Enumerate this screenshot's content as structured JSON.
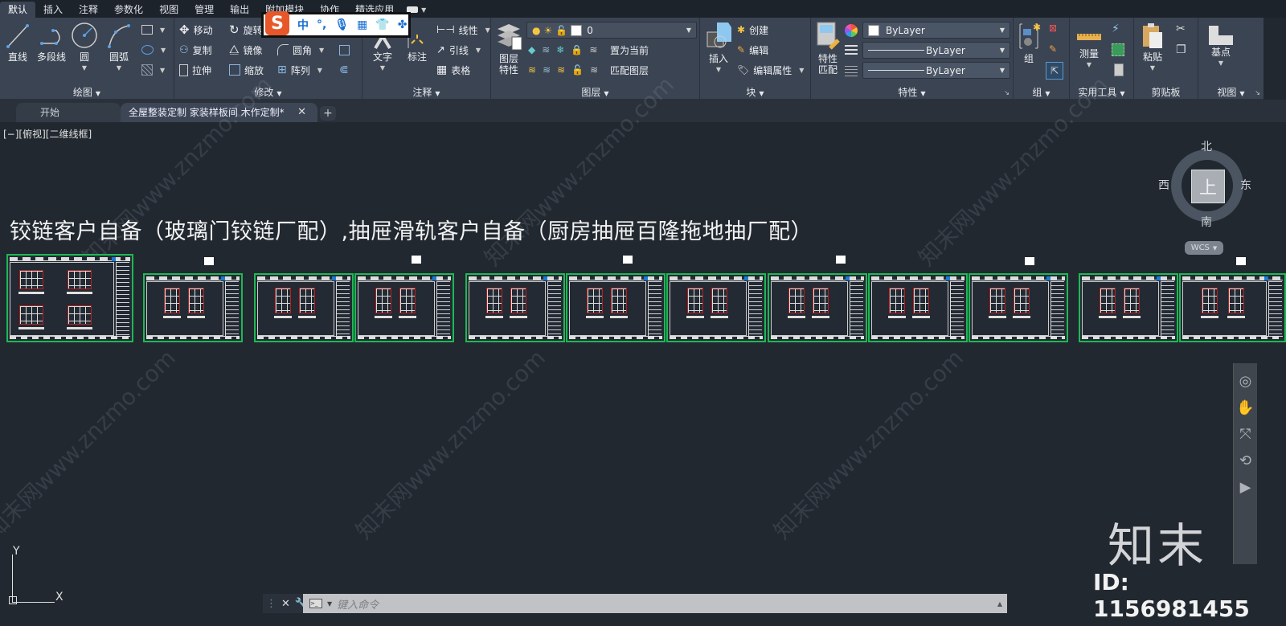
{
  "menu": {
    "tabs": [
      "默认",
      "插入",
      "注释",
      "参数化",
      "视图",
      "管理",
      "输出",
      "附加模块",
      "协作",
      "精选应用"
    ],
    "active": "默认"
  },
  "ime": {
    "logo": "S",
    "items": [
      "中",
      "°,",
      "mic-icon",
      "keyboard-icon",
      "shirt-icon",
      "apps-icon"
    ],
    "mode": "中"
  },
  "ribbon": {
    "draw": {
      "title": "绘图",
      "line": "直线",
      "polyline": "多段线",
      "circle": "圆",
      "arc": "圆弧"
    },
    "modify": {
      "title": "修改",
      "move": "移动",
      "rotate": "旋转",
      "copy": "复制",
      "mirror": "镜像",
      "fillet": "圆角",
      "stretch": "拉伸",
      "scale": "缩放",
      "array": "阵列"
    },
    "annotation": {
      "title": "注释",
      "text": "文字",
      "dimension": "标注",
      "linear": "线性",
      "leader": "引线",
      "table": "表格"
    },
    "layers": {
      "title": "图层",
      "properties_l1": "图层",
      "properties_l2": "特性",
      "current_layer": "0",
      "set_current": "置为当前",
      "match_layer": "匹配图层"
    },
    "block": {
      "title": "块",
      "insert": "插入",
      "create": "创建",
      "edit": "编辑",
      "edit_attributes": "编辑属性"
    },
    "properties": {
      "title": "特性",
      "match_l1": "特性",
      "match_l2": "匹配",
      "color": "ByLayer",
      "linetype": "ByLayer",
      "lineweight": "ByLayer"
    },
    "groups": {
      "title": "组",
      "group": "组"
    },
    "utilities": {
      "title": "实用工具",
      "measure": "测量"
    },
    "clipboard": {
      "title": "剪贴板",
      "paste": "粘贴"
    },
    "view": {
      "title": "视图",
      "base": "基点"
    }
  },
  "filetabs": {
    "start": "开始",
    "current": "全屋整装定制 家装样板间  木作定制*",
    "add": "+"
  },
  "viewport": {
    "label": "[−][俯视][二维线框]",
    "title": "铰链客户自备（玻璃门铰链厂配）,抽屉滑轨客户自备（厨房抽屉百隆拖地抽厂配）",
    "sheet_count": 12
  },
  "viewcube": {
    "north": "北",
    "south": "南",
    "west": "西",
    "east": "东",
    "face": "上",
    "wcs": "WCS"
  },
  "ucs": {
    "x": "X",
    "y": "Y"
  },
  "command": {
    "placeholder": "键入命令"
  },
  "watermark": {
    "brand": "知末",
    "id": "ID: 1156981455",
    "text": "知末网www.znzmo.com"
  },
  "colors": {
    "accent_green": "#1db954",
    "cabinet_red": "#b62020",
    "background": "#212830",
    "ribbon": "#3b4453"
  }
}
